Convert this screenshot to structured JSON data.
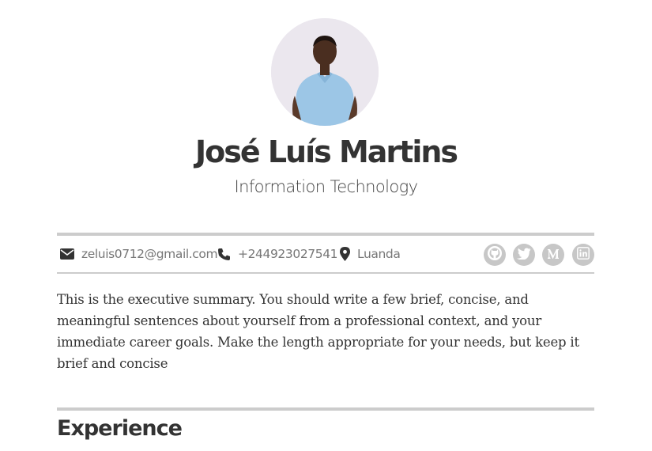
{
  "profile": {
    "name": "José Luís Martins",
    "title": "Information Technology",
    "avatar": "profile-photo"
  },
  "contact": {
    "email": "zeluis0712@gmail.com",
    "phone": "+244923027541",
    "location": "Luanda",
    "icons": [
      "envelope-icon",
      "phone-icon",
      "map-marker-icon"
    ]
  },
  "social": [
    {
      "name": "github-icon"
    },
    {
      "name": "twitter-icon"
    },
    {
      "name": "medium-icon"
    },
    {
      "name": "linkedin-icon"
    }
  ],
  "summary": "This is the executive summary. You should write a few brief, concise, and meaningful sentences about yourself from a professional context, and your immediate career goals. Make the length appropriate for your needs, but keep it brief and concise",
  "sections": {
    "experience_title": "Experience"
  },
  "colors": {
    "text": "#333333",
    "muted": "#777777",
    "rule": "#cccccc",
    "social_bg": "#c7c7c7"
  }
}
